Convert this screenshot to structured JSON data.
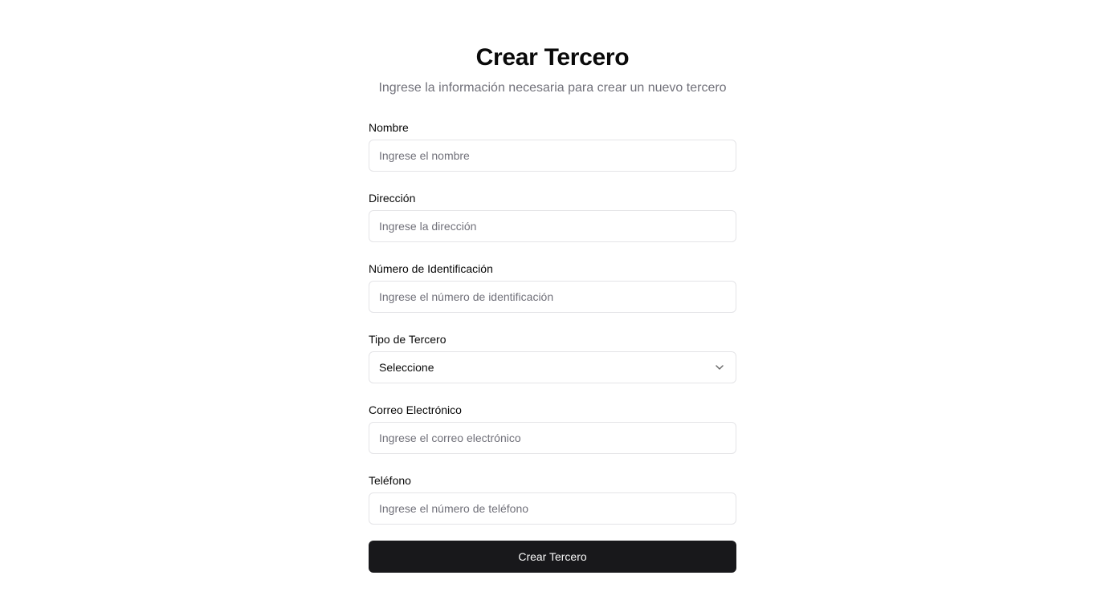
{
  "header": {
    "title": "Crear Tercero",
    "subtitle": "Ingrese la información necesaria para crear un nuevo tercero"
  },
  "form": {
    "nombre": {
      "label": "Nombre",
      "placeholder": "Ingrese el nombre",
      "value": ""
    },
    "direccion": {
      "label": "Dirección",
      "placeholder": "Ingrese la dirección",
      "value": ""
    },
    "identificacion": {
      "label": "Número de Identificación",
      "placeholder": "Ingrese el número de identificación",
      "value": ""
    },
    "tipo_tercero": {
      "label": "Tipo de Tercero",
      "selected": "Seleccione",
      "icon": "chevron-down-icon"
    },
    "correo": {
      "label": "Correo Electrónico",
      "placeholder": "Ingrese el correo electrónico",
      "value": ""
    },
    "telefono": {
      "label": "Teléfono",
      "placeholder": "Ingrese el número de teléfono",
      "value": ""
    },
    "submit_label": "Crear Tercero"
  },
  "colors": {
    "background": "#ffffff",
    "text": "#0a0a0a",
    "muted": "#71717a",
    "border": "#e4e4e7",
    "button_bg": "#18181b",
    "button_text": "#fafafa"
  }
}
